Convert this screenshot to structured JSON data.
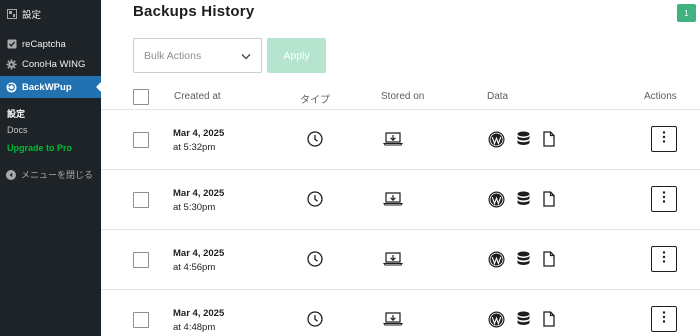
{
  "sidebar": {
    "settings_label": "設定",
    "recaptcha_label": "reCaptcha",
    "conoha_label": "ConoHa WING",
    "backwpup_label": "BackWPup",
    "sub_settings": "設定",
    "sub_docs": "Docs",
    "sub_upgrade": "Upgrade to Pro",
    "collapse_label": "メニューを閉じる",
    "active_color": "#2271b1",
    "pro_color": "#00ba37"
  },
  "main": {
    "title": "Backups History",
    "badge": "1",
    "bulk_actions": "Bulk Actions",
    "apply": "Apply",
    "columns": {
      "created_at": "Created at",
      "type": "タイプ",
      "stored_on": "Stored on",
      "data": "Data",
      "actions": "Actions"
    },
    "rows": [
      {
        "date": "Mar 4, 2025",
        "time": "at 5:32pm"
      },
      {
        "date": "Mar 4, 2025",
        "time": "at 5:30pm"
      },
      {
        "date": "Mar 4, 2025",
        "time": "at 4:56pm"
      },
      {
        "date": "Mar 4, 2025",
        "time": "at 4:48pm"
      }
    ],
    "accent_color": "#3fb27f"
  }
}
